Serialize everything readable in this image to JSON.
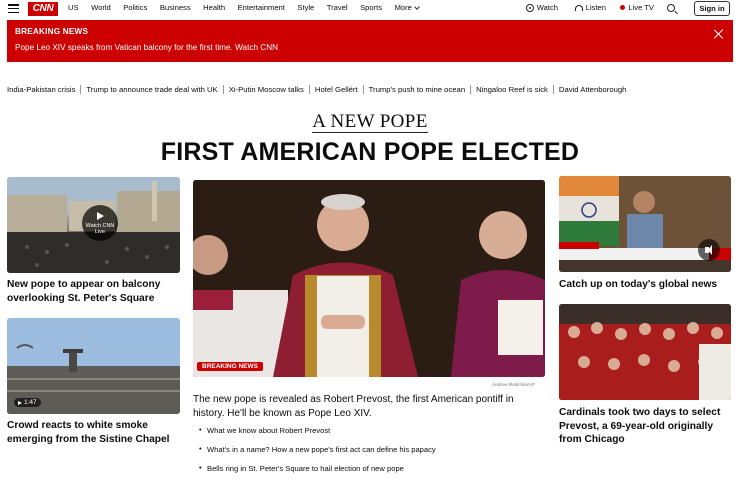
{
  "nav": {
    "logo": "CNN",
    "links": [
      "US",
      "World",
      "Politics",
      "Business",
      "Health",
      "Entertainment",
      "Style",
      "Travel",
      "Sports"
    ],
    "more": "More",
    "watch": "Watch",
    "listen": "Listen",
    "live_tv": "Live TV",
    "signin": "Sign in"
  },
  "breaking": {
    "label": "BREAKING NEWS",
    "text": "Pope Leo XIV speaks from Vatican balcony for the first time. Watch CNN"
  },
  "trending": [
    "India-Pakistan crisis",
    "Trump to announce trade deal with UK",
    "Xi-Putin Moscow talks",
    "Hotel Gellért",
    "Trump's push to mine ocean",
    "Ningaloo Reef is sick",
    "David Attenborough"
  ],
  "kicker": "A NEW POPE",
  "headline": "FIRST AMERICAN POPE ELECTED",
  "left": {
    "card1_title": "New pope to appear on balcony overlooking St. Peter's Square",
    "card1_play": "Watch CNN Live",
    "card2_title": "Crowd reacts to white smoke emerging from the Sistine Chapel",
    "card2_duration": "1:47"
  },
  "center": {
    "tag": "BREAKING NEWS",
    "credit": "Andrew Medichini/AP",
    "dek": "The new pope is revealed as Robert Prevost, the first American pontiff in history. He'll be known as Pope Leo XIV.",
    "bullets": [
      "What we know about Robert Prevost",
      "What's in a name? How a new pope's first act can define his papacy",
      "Bells ring in St. Peter's Square to hail election of new pope"
    ]
  },
  "right": {
    "card1_title": "Catch up on today's global news",
    "card2_title": "Cardinals took two days to select Prevost, a 69-year-old originally from Chicago"
  },
  "colors": {
    "brand": "#cc0000",
    "text": "#0c0c0c"
  }
}
